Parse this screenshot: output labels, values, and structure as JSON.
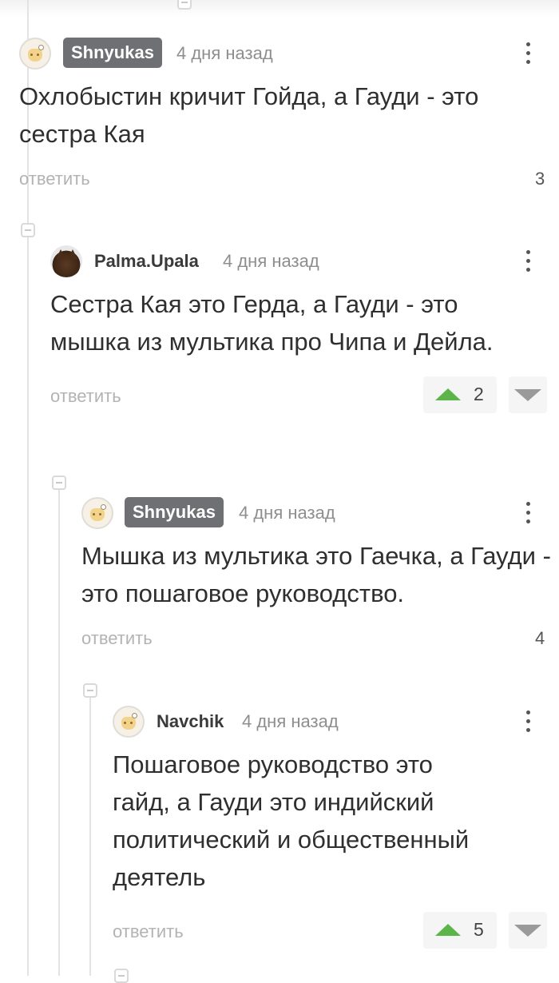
{
  "comments": [
    {
      "username": "Shnyukas",
      "time": "4 дня назад",
      "text": "Охлобыстин кричит Гойда, а Гауди - это сестра Кая",
      "reply_label": "ответить",
      "score": "3"
    },
    {
      "username": "Palma.Upala",
      "time": "4 дня назад",
      "text": "Сестра Кая это Герда, а Гауди - это мышка из мультика про Чипа и Дейла.",
      "reply_label": "ответить",
      "score": "2"
    },
    {
      "username": "Shnyukas",
      "time": "4 дня назад",
      "text": "Мышка из мультика это Гаечка, а Гауди - это пошаговое руководство.",
      "reply_label": "ответить",
      "score": "4"
    },
    {
      "username": "Navchik",
      "time": "4 дня назад",
      "text": "Пошаговое руководство это гайд, а Гауди это индийский политический и общественный деятель",
      "reply_label": "ответить",
      "score": "5"
    }
  ],
  "icons": {
    "menu": "more-vertical-icon",
    "upvote": "arrow-up-icon",
    "downvote": "arrow-down-icon",
    "collapse": "collapse-minus-icon"
  },
  "colors": {
    "upvote": "#5bb548",
    "badge_bg": "#6f7074",
    "reply_text": "#b3b3b3",
    "thread_line": "#e3e3e3"
  }
}
